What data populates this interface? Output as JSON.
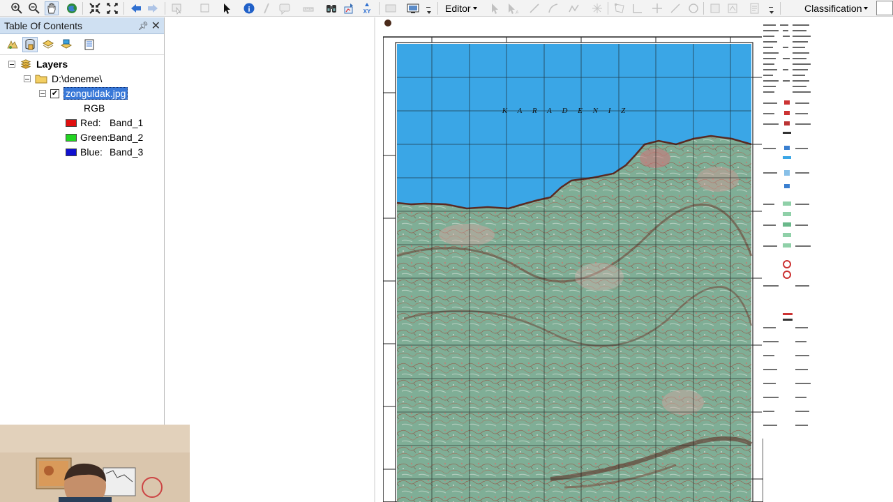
{
  "toolbar": {
    "editor_label": "Editor",
    "classification_label": "Classification",
    "icons": [
      "zoom-in-icon",
      "zoom-out-icon",
      "pan-icon",
      "full-extent-icon",
      "fixed-zoom-in-icon",
      "fixed-zoom-out-icon",
      "back-icon",
      "forward-icon",
      "select-features-icon",
      "clear-selection-icon",
      "select-elements-icon",
      "identify-icon",
      "hyperlink-icon",
      "html-popup-icon",
      "measure-icon",
      "find-icon",
      "find-route-icon",
      "goto-xy-icon",
      "time-slider-icon",
      "viewer-icon"
    ]
  },
  "toc": {
    "title": "Table Of Contents",
    "pin_icon": "pin-icon",
    "close_icon": "close-icon",
    "tools": [
      "list-by-drawing-order-icon",
      "list-by-source-icon",
      "list-by-visibility-icon",
      "list-by-selection-icon",
      "options-icon"
    ],
    "layers_label": "Layers",
    "folder_label": "D:\\deneme\\",
    "layer_name": "zonguldak.jpg",
    "layer_checked": true,
    "renderer_label": "RGB",
    "bands": [
      {
        "channel": "Red:",
        "band": "Band_1",
        "color": "#e01010"
      },
      {
        "channel": "Green:",
        "band": "Band_2",
        "color": "#22d422"
      },
      {
        "channel": "Blue:",
        "band": "Band_3",
        "color": "#1010d0"
      }
    ]
  },
  "map": {
    "sea_label": "K A R A D E N I Z",
    "sea_color": "#3aa6e6",
    "land_color": "#7fae96"
  },
  "webcam": {
    "visible": true
  }
}
